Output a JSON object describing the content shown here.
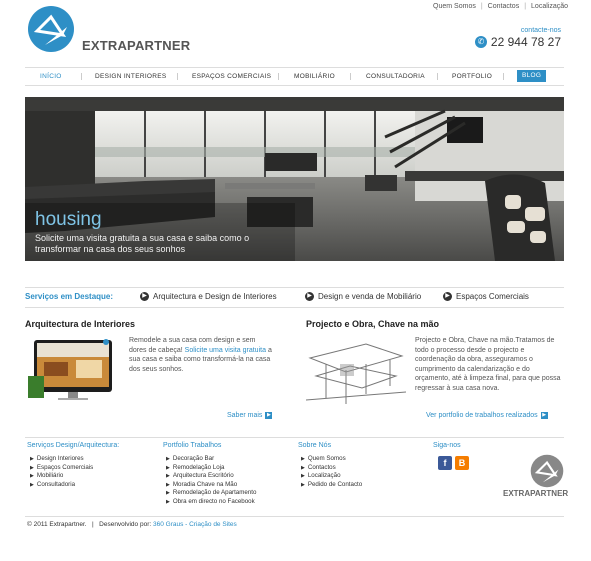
{
  "top_links": [
    "Quem Somos",
    "Contactos",
    "Localização"
  ],
  "brand": "EXTRAPARTNER",
  "contact": {
    "label": "contacte-nos",
    "phone": "22 944 78 27"
  },
  "nav": {
    "items": [
      "INÍCIO",
      "DESIGN INTERIORES",
      "ESPAÇOS COMERCIAIS",
      "MOBILIÁRIO",
      "CONSULTADORIA",
      "PORTFOLIO"
    ],
    "blog": "BLOG"
  },
  "hero": {
    "title": "housing",
    "subtitle": "Solicite uma visita gratuita a sua casa e saiba como o transformar na casa dos seus sonhos"
  },
  "featured": {
    "title": "Serviços em Destaque:",
    "items": [
      "Arquitectura e Design de Interiores",
      "Design e venda de Mobiliário",
      "Espaços Comerciais"
    ]
  },
  "left_col": {
    "title": "Arquitectura de Interiores",
    "text_before": "Remodele a sua casa com design e sem dores de cabeça!",
    "text_link": "Solicite uma visita gratuita",
    "text_after": "a sua casa e saiba como transformá-la na casa dos seus sonhos.",
    "more": "Saber mais"
  },
  "right_col": {
    "title": "Projecto e Obra, Chave na mão",
    "text": "Projecto e Obra, Chave na mão.Tratamos de todo o processo desde o projecto e coordenação da obra, asseguramos o cumprimento da calendarização e do orçamento, até à limpeza final, para que possa regressar à sua casa nova.",
    "more": "Ver portfolio de trabalhos realizados"
  },
  "footer": {
    "services": {
      "title": "Serviços Design/Arquitectura:",
      "items": [
        "Design Interiores",
        "Espaços Comerciais",
        "Mobiliário",
        "Consultadoria"
      ]
    },
    "portfolio": {
      "title": "Portfolio Trabalhos",
      "items": [
        "Decoração Bar",
        "Remodelação Loja",
        "Arquitectura Escritório",
        "Moradia Chave na Mão",
        "Remodelação de Apartamento",
        "Obra em directo no Facebook"
      ]
    },
    "about": {
      "title": "Sobre Nós",
      "items": [
        "Quem Somos",
        "Contactos",
        "Localização",
        "Pedido de Contacto"
      ]
    },
    "social": {
      "title": "Siga-nos",
      "icons": [
        "facebook-icon",
        "blogger-icon"
      ]
    },
    "brand": "EXTRAPARTNER"
  },
  "copyright": {
    "text": "© 2011 Extrapartner.",
    "dev_label": "Desenvolvido por:",
    "dev_link": "360 Graus - Criação de Sites"
  },
  "colors": {
    "accent": "#2e8fc6",
    "text": "#333333"
  }
}
